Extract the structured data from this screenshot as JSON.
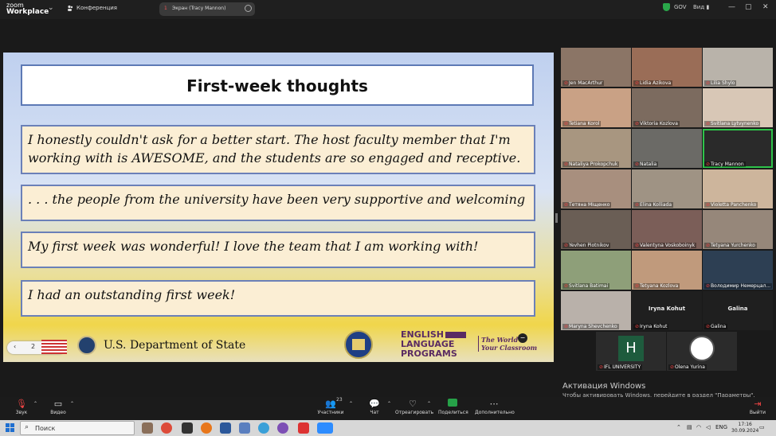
{
  "app": {
    "logo_line1": "zoom",
    "logo_line2": "Workplace",
    "conference_label": "Конференция",
    "screen_share_number": "1",
    "screen_share_label": "Экран (Tracy Mannon)",
    "security_label": "GOV",
    "view_label": "Вид"
  },
  "slide": {
    "title": "First-week thoughts",
    "quotes": [
      "I honestly couldn't ask for a better start. The host faculty member that I'm working with is AWESOME, and the students are so engaged and receptive.",
      ". . . the people from the university have been very supportive and welcoming",
      "My first week was wonderful! I love the team that I am working with!",
      "I had an outstanding first week!"
    ],
    "page_number": "2",
    "dept_state": "U.S. Department of State",
    "elp_line1": "ENGLISH",
    "elp_line2": "LANGUAGE",
    "elp_line3": "PROGRAMS",
    "tagline": "The World is Your Classroom"
  },
  "gallery": {
    "participants": [
      "Jen MacArthur",
      "Lidia Azikova",
      "Lilia Shylo",
      "Tetiana Korol",
      "Viktoria Kozlova",
      "Svitlana Lytvynenko",
      "Nataliya Prokopchuk",
      "Natalia",
      "Tracy Mannon",
      "Тетяна Міщенко",
      "Elina Kolliada",
      "Violetta Panchenko",
      "Yevhen Piotnikov",
      "Valentyna Voskoboinyk",
      "Tetyana Yurchenko",
      "Svitlana Batimai",
      "Tetyana Kozlova",
      "Володимир Немерцал...",
      "Maryna Shevchenko",
      "Iryna Kohut",
      "Galina",
      "IFL UNIVERSITY",
      "Olena Yurina"
    ],
    "iryna_big": "Iryna Kohut",
    "galina_big": "Galina",
    "h_letter": "H"
  },
  "activation": {
    "title": "Активация Windows",
    "subtitle": "Чтобы активировать Windows, перейдите в раздел \"Параметры\"."
  },
  "toolbar": {
    "audio": "Звук",
    "video": "Видео",
    "participants": "Участники",
    "participants_count": "23",
    "chat": "Чат",
    "react": "Отреагировать",
    "share": "Поделиться",
    "more": "Дополнительно",
    "leave": "Выйти"
  },
  "taskbar": {
    "search_placeholder": "Поиск",
    "lang": "ENG",
    "time": "17:16",
    "date": "30.09.2024"
  },
  "colors": {
    "active_speaker": "#2ec34a",
    "share_green": "#26a148",
    "elp_purple": "#5a2b63"
  }
}
